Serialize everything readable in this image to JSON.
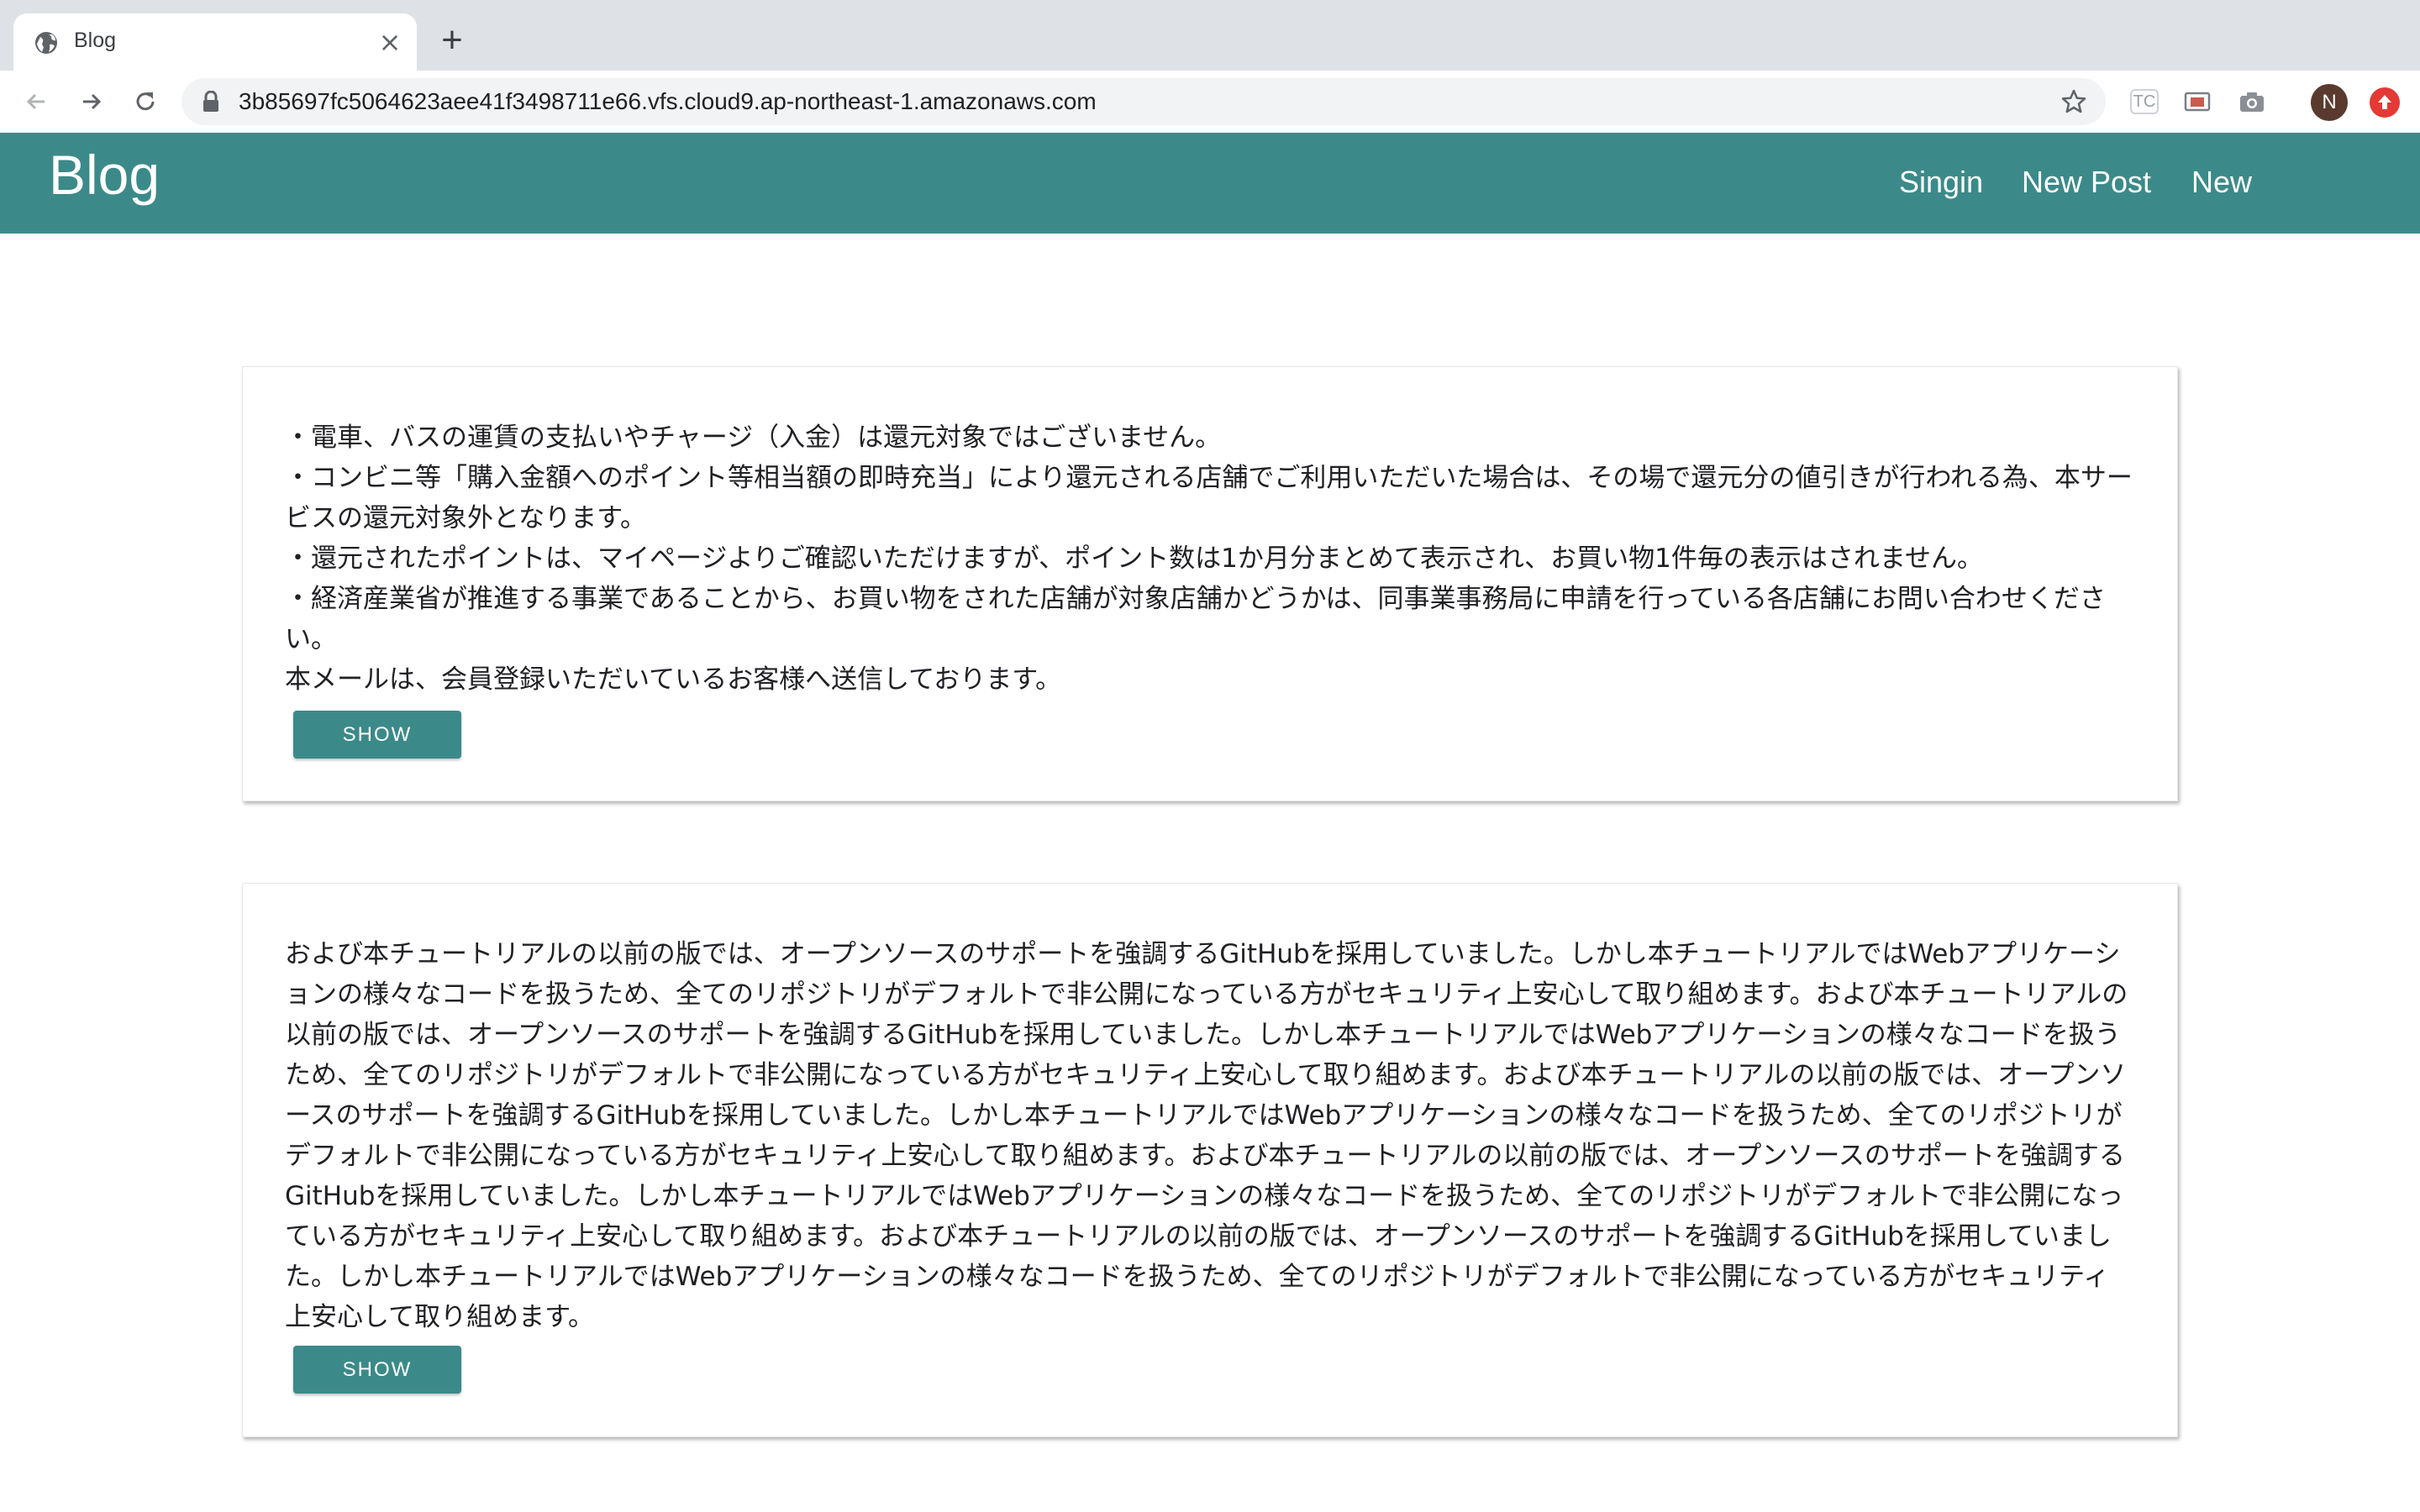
{
  "browser": {
    "tab_title": "Blog",
    "tab_close": "×",
    "new_tab": "+",
    "url": "3b85697fc5064623aee41f3498711e66.vfs.cloud9.ap-northeast-1.amazonaws.com",
    "extensions": [
      "tc-icon",
      "cast-icon",
      "camera-icon"
    ],
    "extension_tc_label": "TC",
    "profile_initial": "N"
  },
  "navbar": {
    "brand": "Blog",
    "links": [
      "Singin",
      "New Post",
      "New"
    ],
    "color": "#3b8a89"
  },
  "posts": [
    {
      "body": "・電車、バスの運賃の支払いやチャージ（入金）は還元対象ではございません。\n・コンビニ等「購入金額へのポイント等相当額の即時充当」により還元される店舗でご利用いただいた場合は、その場で還元分の値引きが行われる為、本サービスの還元対象外となります。\n・還元されたポイントは、マイページよりご確認いただけますが、ポイント数は1か月分まとめて表示され、お買い物1件毎の表示はされません。\n・経済産業省が推進する事業であることから、お買い物をされた店舗が対象店舗かどうかは、同事業事務局に申請を行っている各店舗にお問い合わせください。\n本メールは、会員登録いただいているお客様へ送信しております。",
      "button": "SHOW"
    },
    {
      "body": "および本チュートリアルの以前の版では、オープンソースのサポートを強調するGitHubを採用していました。しかし本チュートリアルではWebアプリケーションの様々なコードを扱うため、全てのリポジトリがデフォルトで非公開になっている方がセキュリティ上安心して取り組めます。および本チュートリアルの以前の版では、オープンソースのサポートを強調するGitHubを採用していました。しかし本チュートリアルではWebアプリケーションの様々なコードを扱うため、全てのリポジトリがデフォルトで非公開になっている方がセキュリティ上安心して取り組めます。および本チュートリアルの以前の版では、オープンソースのサポートを強調するGitHubを採用していました。しかし本チュートリアルではWebアプリケーションの様々なコードを扱うため、全てのリポジトリがデフォルトで非公開になっている方がセキュリティ上安心して取り組めます。および本チュートリアルの以前の版では、オープンソースのサポートを強調するGitHubを採用していました。しかし本チュートリアルではWebアプリケーションの様々なコードを扱うため、全てのリポジトリがデフォルトで非公開になっている方がセキュリティ上安心して取り組めます。および本チュートリアルの以前の版では、オープンソースのサポートを強調するGitHubを採用していました。しかし本チュートリアルではWebアプリケーションの様々なコードを扱うため、全てのリポジトリがデフォルトで非公開になっている方がセキュリティ上安心して取り組めます。",
      "button": "SHOW"
    }
  ]
}
